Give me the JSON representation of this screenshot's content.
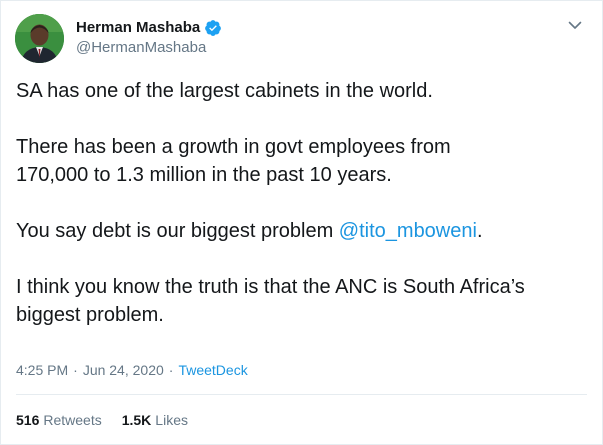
{
  "author": {
    "display_name": "Herman Mashaba",
    "handle": "@HermanMashaba",
    "verified": true,
    "avatar_icon": "avatar-photo"
  },
  "tweet": {
    "paragraphs": [
      {
        "text": "SA has one of the largest cabinets in the world."
      },
      {
        "lines": [
          "There has been a growth in govt employees from",
          "170,000 to 1.3 million in the past 10 years."
        ]
      },
      {
        "before": "You say debt is our biggest problem ",
        "mention": "@tito_mboweni",
        "after": "."
      },
      {
        "lines": [
          "I think you know the truth is that the ANC is South Africa’s",
          "biggest problem."
        ]
      }
    ]
  },
  "meta": {
    "time": "4:25 PM",
    "separator1": "·",
    "date": "Jun 24, 2020",
    "separator2": "·",
    "source": "TweetDeck"
  },
  "stats": {
    "retweets_count": "516",
    "retweets_label": "Retweets",
    "likes_count": "1.5K",
    "likes_label": "Likes"
  },
  "colors": {
    "link": "#1b95e0",
    "text": "#14171a",
    "secondary": "#657786",
    "verified_badge": "#1da1f2"
  }
}
